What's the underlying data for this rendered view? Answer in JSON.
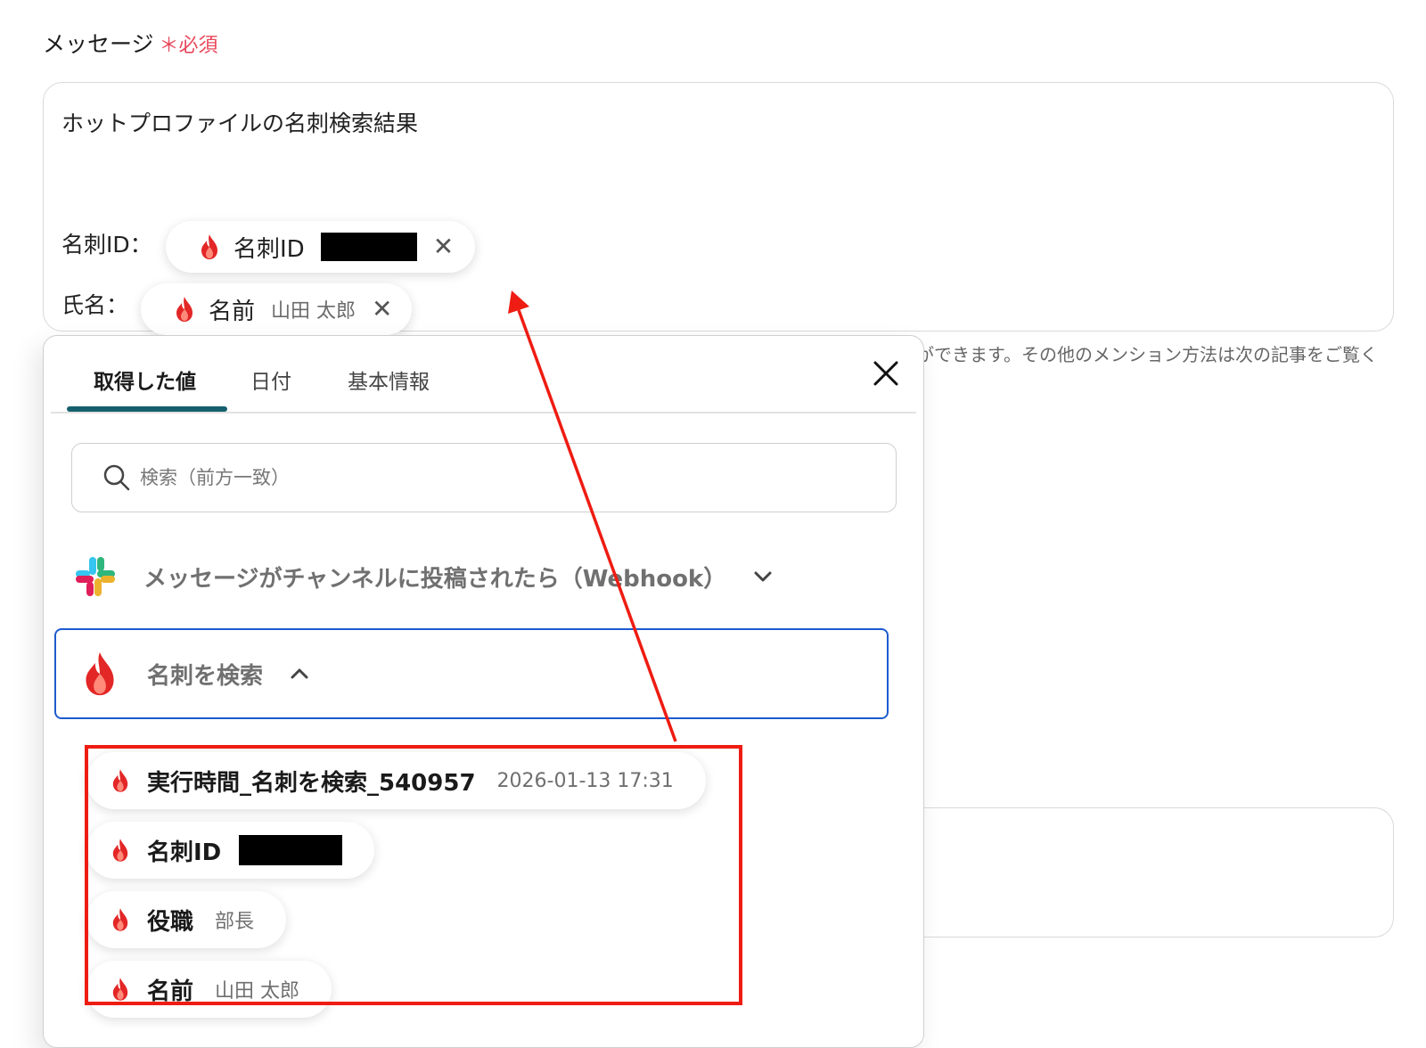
{
  "field": {
    "label": "メッセージ",
    "required_mark": "＊",
    "required_text": "必須"
  },
  "editor": {
    "line1": "ホットプロファイルの名刺検索結果",
    "row1_label": "名刺ID：",
    "row2_label": "氏名：",
    "pill_card_id": "名刺ID",
    "pill_name": "名前",
    "pill_name_value": "山田 太郎"
  },
  "helper_text": "ができます。その他のメンション方法は次の記事をご覧く",
  "panel": {
    "tabs": [
      "取得した値",
      "日付",
      "基本情報"
    ],
    "search_placeholder": "検索（前方一致）",
    "group_slack": "メッセージがチャンネルに投稿されたら（Webhook）",
    "group_search": "名刺を検索",
    "items": [
      {
        "label": "実行時間_名刺を検索_540957",
        "value": "2026-01-13 17:31"
      },
      {
        "label": "名刺ID",
        "value": ""
      },
      {
        "label": "役職",
        "value": "部長"
      },
      {
        "label": "名前",
        "value": "山田 太郎"
      }
    ]
  },
  "colors": {
    "accent_tab": "#16606e",
    "selected_border": "#1d5bcf",
    "highlight_red": "#ee1c12",
    "required_red": "#e8485b"
  },
  "icons": [
    "fire-icon",
    "close-icon",
    "search-icon",
    "slack-icon",
    "chevron-down-icon",
    "chevron-up-icon"
  ]
}
